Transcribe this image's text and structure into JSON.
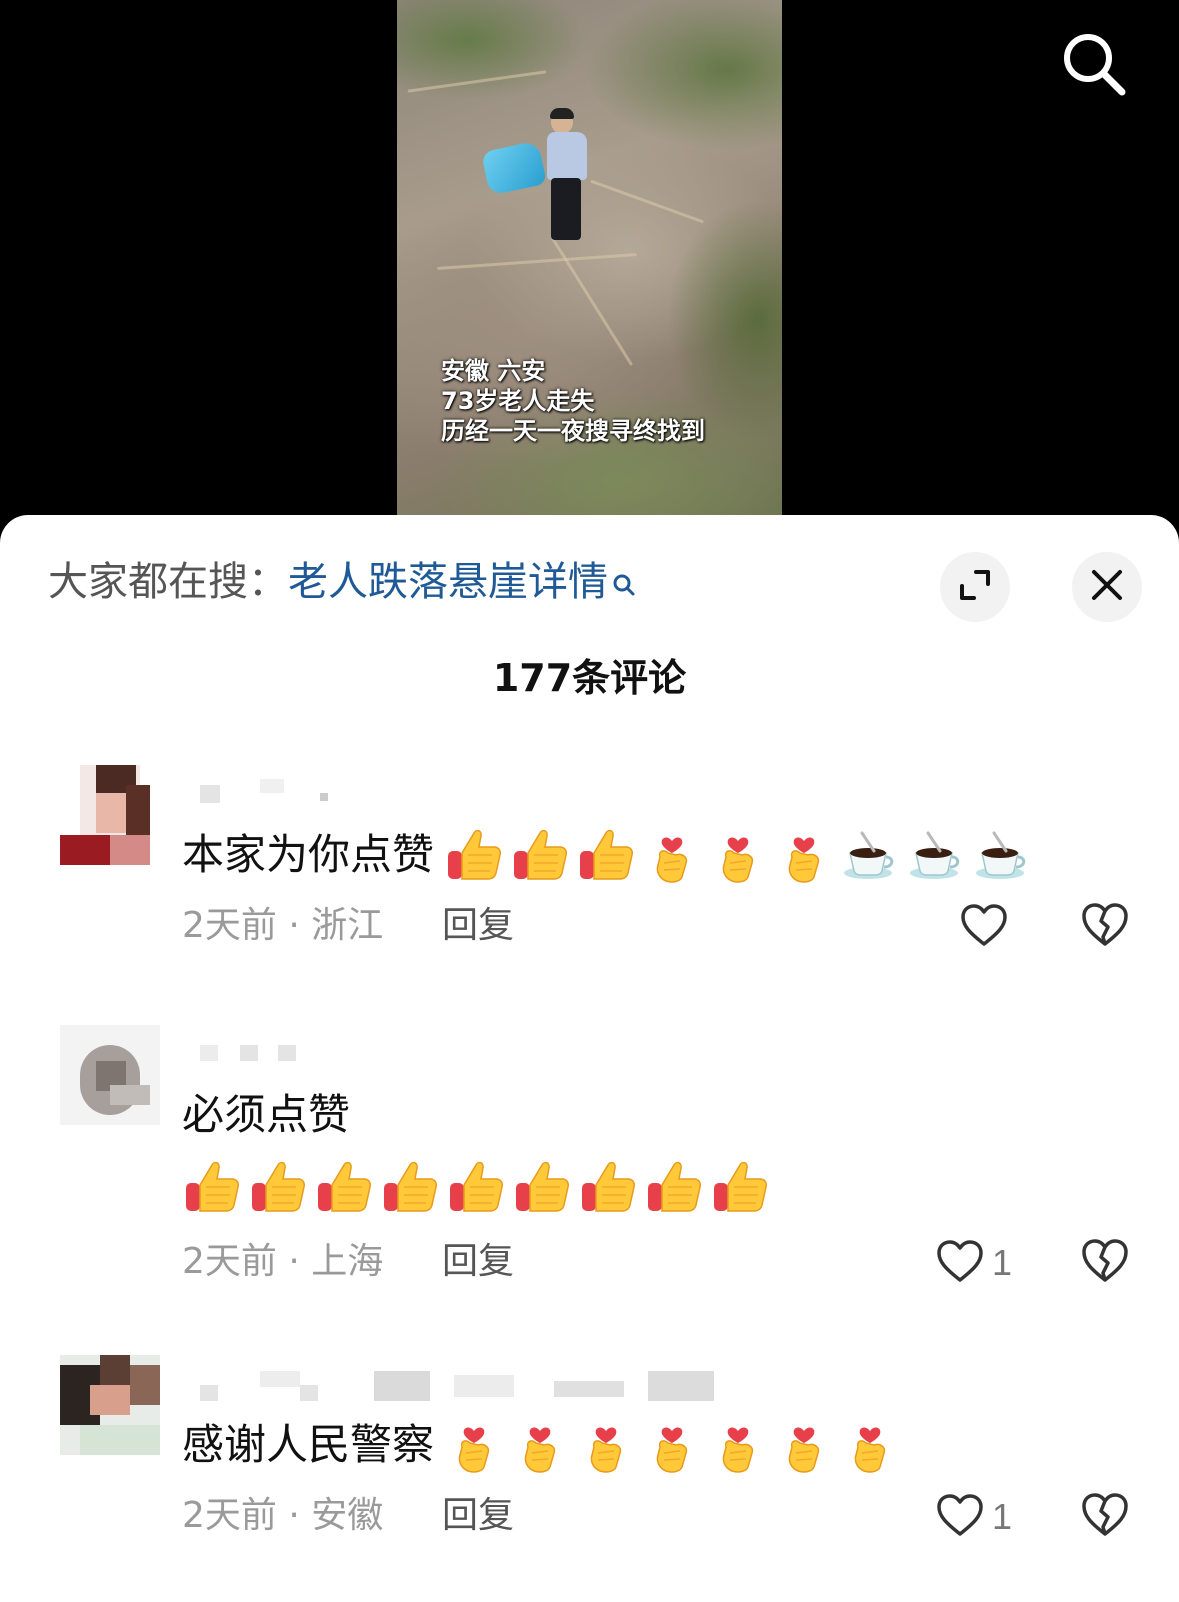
{
  "video": {
    "caption": [
      "安徽 六安",
      "73岁老人走失",
      "历经一天一夜搜寻终找到"
    ]
  },
  "sheet": {
    "hot_search_label": "大家都在搜：",
    "hot_search_term": "老人跌落悬崖详情",
    "comment_count": "177条评论"
  },
  "comments": [
    {
      "text": "本家为你点赞",
      "emojis": [
        "thumbs-up",
        "thumbs-up",
        "thumbs-up",
        "finger-heart",
        "finger-heart",
        "finger-heart",
        "coffee",
        "coffee",
        "coffee"
      ],
      "meta": "2天前 · 浙江",
      "reply": "回复",
      "likes": ""
    },
    {
      "text": "必须点赞",
      "emojis": [
        "thumbs-up",
        "thumbs-up",
        "thumbs-up",
        "thumbs-up",
        "thumbs-up",
        "thumbs-up",
        "thumbs-up",
        "thumbs-up",
        "thumbs-up"
      ],
      "meta": "2天前 · 上海",
      "reply": "回复",
      "likes": "1"
    },
    {
      "text": "感谢人民警察",
      "emojis": [
        "finger-heart",
        "finger-heart",
        "finger-heart",
        "finger-heart",
        "finger-heart",
        "finger-heart",
        "finger-heart"
      ],
      "meta": "2天前 · 安徽",
      "reply": "回复",
      "likes": "1"
    }
  ],
  "colors": {
    "link": "#1f5a96",
    "meta": "#9a9a9a",
    "emoji_yellow": "#ffc93a",
    "emoji_red": "#e8404a"
  },
  "icons": [
    "search-icon",
    "expand-icon",
    "close-icon",
    "heart-icon",
    "broken-heart-icon",
    "thumbs-up-icon",
    "finger-heart-icon",
    "coffee-icon"
  ]
}
